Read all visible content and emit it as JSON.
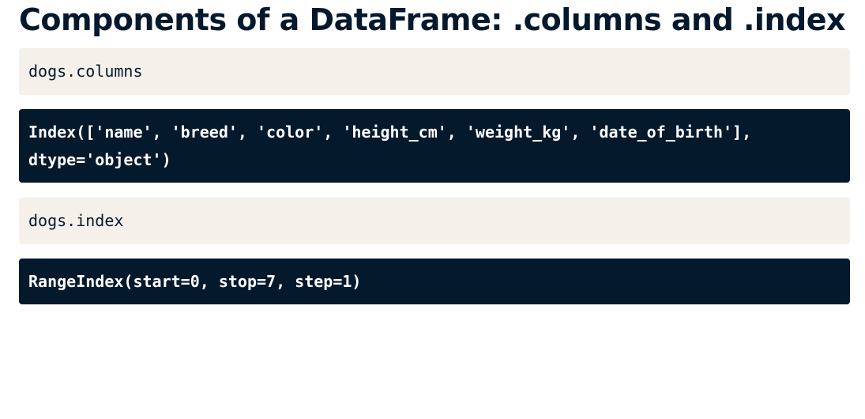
{
  "title": "Components of a DataFrame: .columns and .index",
  "blocks": {
    "columns_input": "dogs.columns",
    "columns_output_line1": "Index(['name', 'breed', 'color', 'height_cm', 'weight_kg', 'date_of_birth'],",
    "columns_output_line2": "dtype='object')",
    "index_input": "dogs.index",
    "index_output": "RangeIndex(start=0, stop=7, step=1)"
  },
  "colors": {
    "title": "#05192d",
    "input_background": "#f5f1ea",
    "output_background": "#05192d",
    "output_text": "#ffffff"
  }
}
